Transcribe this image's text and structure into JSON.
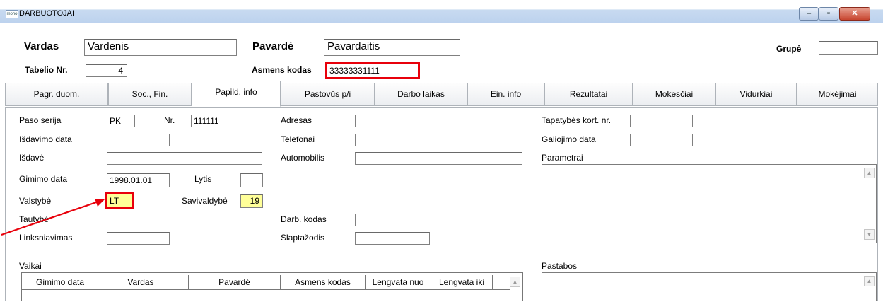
{
  "window": {
    "title": "DARBUOTOJAI",
    "app_icon_text": "moho",
    "buttons": {
      "minimize": "–",
      "maximize": "▫",
      "close": "✕"
    }
  },
  "header": {
    "vardas_label": "Vardas",
    "vardas_value": "Vardenis",
    "pavarde_label": "Pavardė",
    "pavarde_value": "Pavardaitis",
    "grupe_label": "Grupė",
    "grupe_value": "",
    "tabelio_label": "Tabelio Nr.",
    "tabelio_value": "4",
    "asmens_kodas_label": "Asmens kodas",
    "asmens_kodas_value": "33333331111"
  },
  "tabs": [
    {
      "label": "Pagr. duom."
    },
    {
      "label": "Soc., Fin."
    },
    {
      "label": "Papild. info"
    },
    {
      "label": "Pastovūs p/i"
    },
    {
      "label": "Darbo laikas"
    },
    {
      "label": "Ein. info"
    },
    {
      "label": "Rezultatai"
    },
    {
      "label": "Mokesčiai"
    },
    {
      "label": "Vidurkiai"
    },
    {
      "label": "Mokėjimai"
    }
  ],
  "active_tab": "Papild. info",
  "form": {
    "paso_serija_label": "Paso serija",
    "paso_serija_value": "PK",
    "nr_label": "Nr.",
    "nr_value": "111111",
    "isdavimo_data_label": "Išdavimo data",
    "isdavimo_data_value": "",
    "isdave_label": "Išdavė",
    "isdave_value": "",
    "gimimo_data_label": "Gimimo data",
    "gimimo_data_value": "1998.01.01",
    "lytis_label": "Lytis",
    "lytis_value": "",
    "valstybe_label": "Valstybė",
    "valstybe_value": "LT",
    "savivaldybe_label": "Savivaldybė",
    "savivaldybe_value": "19",
    "tautybe_label": "Tautybė",
    "tautybe_value": "",
    "linksniavimas_label": "Linksniavimas",
    "linksniavimas_value": "",
    "adresas_label": "Adresas",
    "adresas_value": "",
    "telefonai_label": "Telefonai",
    "telefonai_value": "",
    "automobilis_label": "Automobilis",
    "automobilis_value": "",
    "darb_kodas_label": "Darb. kodas",
    "darb_kodas_value": "",
    "slaptazodis_label": "Slaptažodis",
    "slaptazodis_value": "",
    "tapatybes_label": "Tapatybės kort. nr.",
    "tapatybes_value": "",
    "galiojimo_label": "Galiojimo data",
    "galiojimo_value": "",
    "parametrai_label": "Parametrai",
    "pastabos_label": "Pastabos"
  },
  "vaikai": {
    "label": "Vaikai",
    "columns": [
      "Gimimo data",
      "Vardas",
      "Pavardė",
      "Asmens kodas",
      "Lengvata nuo",
      "Lengvata iki"
    ]
  },
  "colors": {
    "highlight_red": "#e8000b",
    "yellow_field": "#ffff99"
  }
}
